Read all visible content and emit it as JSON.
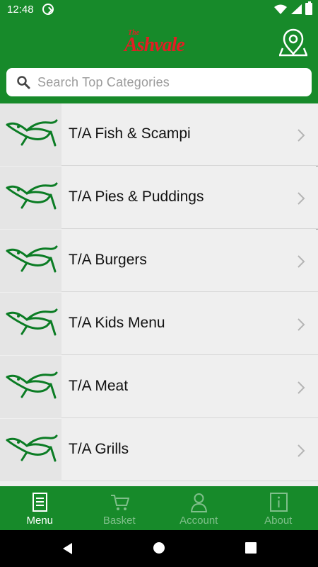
{
  "status_bar": {
    "time": "12:48"
  },
  "header": {
    "logo_small": "The",
    "logo_text": "Ashvale",
    "location_icon": "map-pin-icon"
  },
  "search": {
    "placeholder": "Search Top Categories"
  },
  "categories": [
    {
      "label": "T/A Fish & Scampi"
    },
    {
      "label": "T/A Pies & Puddings"
    },
    {
      "label": "T/A Burgers"
    },
    {
      "label": "T/A Kids Menu"
    },
    {
      "label": "T/A Meat"
    },
    {
      "label": "T/A Grills"
    }
  ],
  "bottom_nav": [
    {
      "label": "Menu",
      "active": true
    },
    {
      "label": "Basket",
      "active": false
    },
    {
      "label": "Account",
      "active": false
    },
    {
      "label": "About",
      "active": false
    }
  ],
  "colors": {
    "brand_green": "#178a2a",
    "logo_red": "#e51c23",
    "fish_green": "#0b7c24"
  }
}
